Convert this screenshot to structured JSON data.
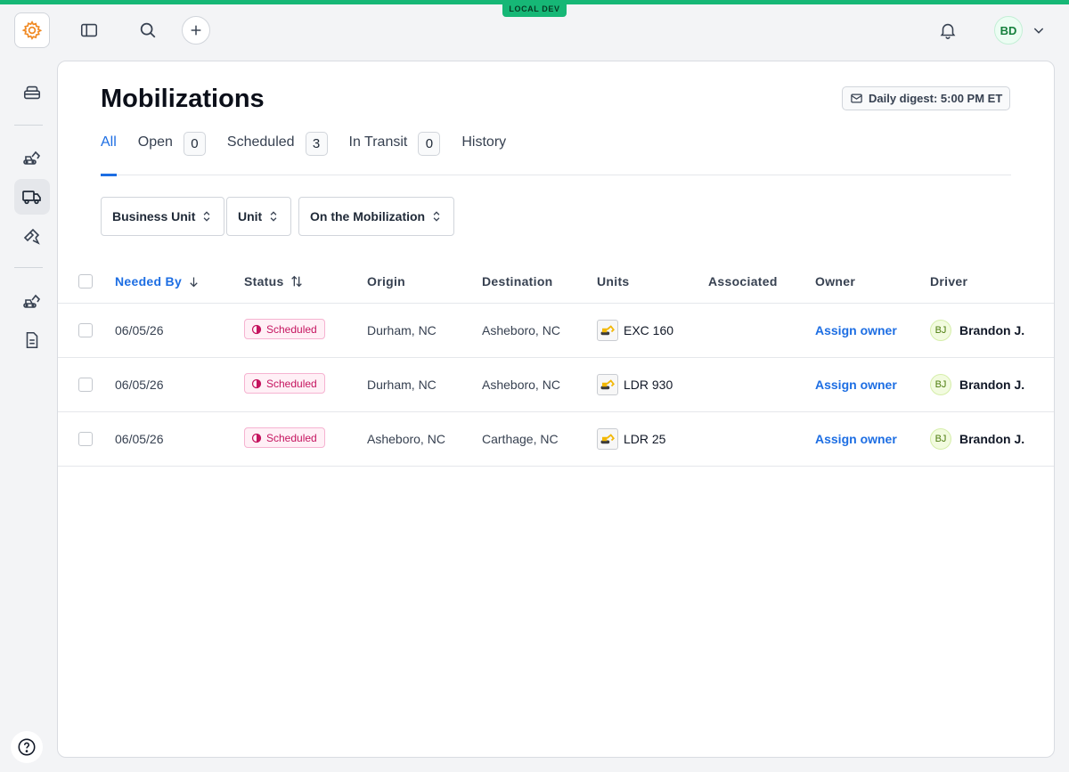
{
  "environment_badge": "LOCAL DEV",
  "user": {
    "initials": "BD"
  },
  "page": {
    "title": "Mobilizations",
    "digest_label": "Daily digest: 5:00 PM ET"
  },
  "tabs": [
    {
      "label": "All",
      "count": null,
      "active": true
    },
    {
      "label": "Open",
      "count": "0"
    },
    {
      "label": "Scheduled",
      "count": "3"
    },
    {
      "label": "In Transit",
      "count": "0"
    },
    {
      "label": "History",
      "count": null
    }
  ],
  "filters": [
    {
      "label": "Business Unit"
    },
    {
      "label": "Unit"
    },
    {
      "label": "On the Mobilization"
    }
  ],
  "table": {
    "columns": {
      "needed_by": "Needed By",
      "status": "Status",
      "origin": "Origin",
      "destination": "Destination",
      "units": "Units",
      "associated": "Associated",
      "owner": "Owner",
      "driver": "Driver"
    },
    "rows": [
      {
        "needed_by": "06/05/26",
        "status": "Scheduled",
        "origin": "Durham, NC",
        "destination": "Asheboro, NC",
        "unit": "EXC 160",
        "associated": "",
        "owner": "Assign owner",
        "driver_initials": "BJ",
        "driver": "Brandon J."
      },
      {
        "needed_by": "06/05/26",
        "status": "Scheduled",
        "origin": "Durham, NC",
        "destination": "Asheboro, NC",
        "unit": "LDR 930",
        "associated": "",
        "owner": "Assign owner",
        "driver_initials": "BJ",
        "driver": "Brandon J."
      },
      {
        "needed_by": "06/05/26",
        "status": "Scheduled",
        "origin": "Asheboro, NC",
        "destination": "Carthage, NC",
        "unit": "LDR 25",
        "associated": "",
        "owner": "Assign owner",
        "driver_initials": "BJ",
        "driver": "Brandon J."
      }
    ]
  },
  "colors": {
    "accent": "#1d6ee3",
    "env": "#16b776",
    "status_scheduled": "#c5145f"
  }
}
